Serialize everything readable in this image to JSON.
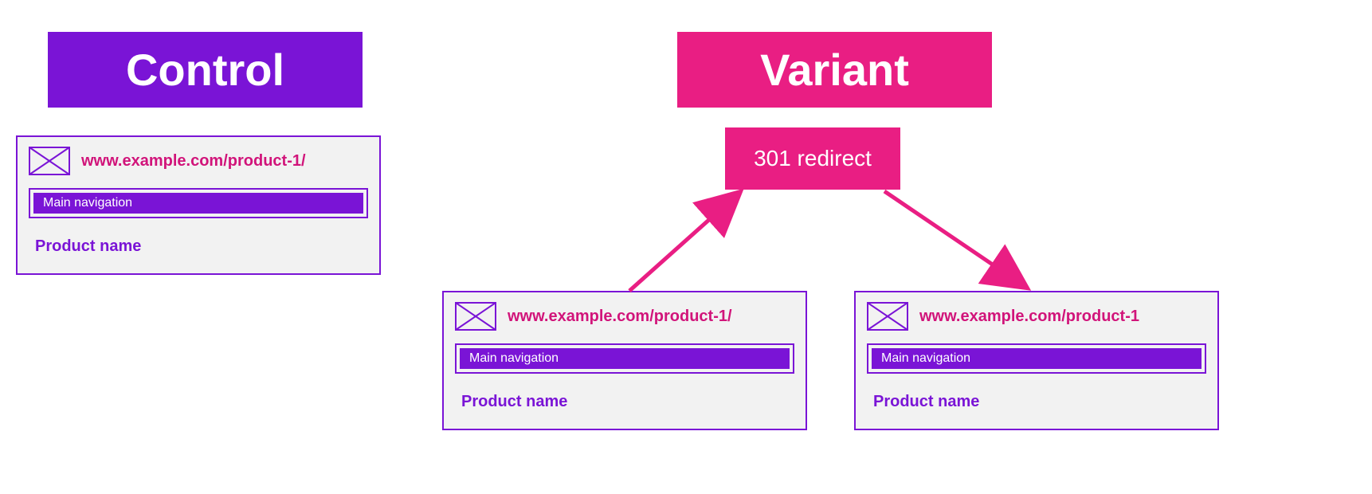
{
  "control": {
    "title": "Control",
    "url": "www.example.com/product-1/",
    "nav_label": "Main navigation",
    "product_name": "Product name"
  },
  "variant": {
    "title": "Variant",
    "redirect_label": "301 redirect",
    "card1": {
      "url": "www.example.com/product-1/",
      "nav_label": "Main navigation",
      "product_name": "Product name"
    },
    "card2": {
      "url": "www.example.com/product-1",
      "nav_label": "Main navigation",
      "product_name": "Product name"
    }
  },
  "colors": {
    "purple": "#7a14d6",
    "pink": "#e91e83",
    "pink_text": "#d1147a",
    "card_bg": "#f2f2f2"
  }
}
